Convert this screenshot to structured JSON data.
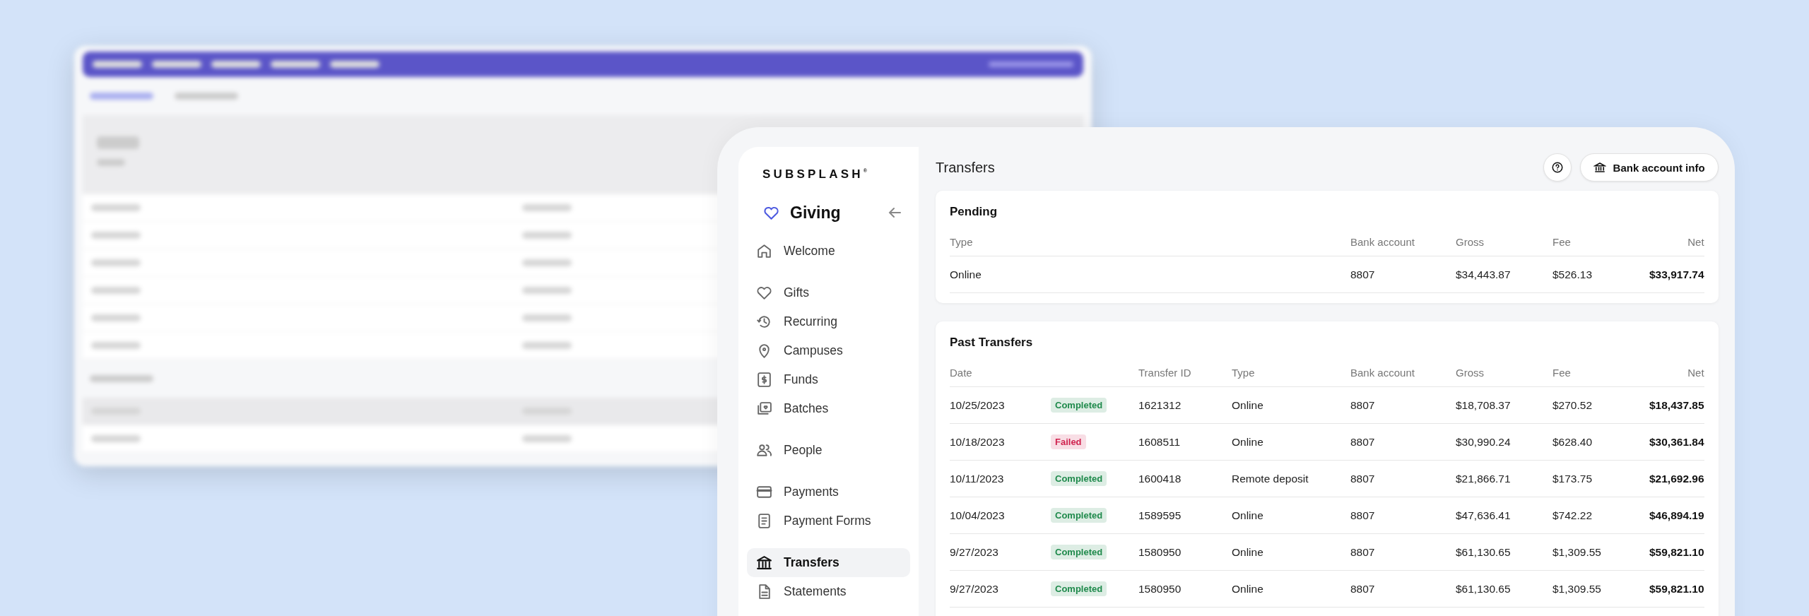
{
  "sidebar": {
    "logo": "SUBSPLASH$^{®}$",
    "app_title": "Giving",
    "sections": [
      {
        "items": [
          {
            "label": "Welcome",
            "selected": false
          }
        ]
      },
      {
        "items": [
          {
            "label": "Gifts",
            "selected": false
          },
          {
            "label": "Recurring",
            "selected": false
          },
          {
            "label": "Campuses",
            "selected": false
          },
          {
            "label": "Funds",
            "selected": false
          },
          {
            "label": "Batches",
            "selected": false
          }
        ]
      },
      {
        "items": [
          {
            "label": "People",
            "selected": false
          }
        ]
      },
      {
        "items": [
          {
            "label": "Payments",
            "selected": false
          },
          {
            "label": "Payment Forms",
            "selected": false
          }
        ]
      },
      {
        "items": [
          {
            "label": "Transfers",
            "selected": true
          },
          {
            "label": "Statements",
            "selected": false
          }
        ]
      }
    ]
  },
  "page_title": "Transfers",
  "bank_button": "Bank account info",
  "pending": {
    "title": "Pending",
    "columns": [
      "Type",
      "Bank account",
      "Gross",
      "Fee",
      "Net"
    ],
    "rows": [
      {
        "type": "Online",
        "bank_account": "8807",
        "gross": "$34,443.87",
        "fee": "$526.13",
        "net": "$33,917.74"
      }
    ]
  },
  "past": {
    "title": "Past Transfers",
    "columns": [
      "Date",
      "Transfer ID",
      "Type",
      "Bank account",
      "Gross",
      "Fee",
      "Net"
    ],
    "rows": [
      {
        "date": "10/25/2023",
        "status": "Completed",
        "color": "#1f8a4c",
        "transfer_id": "1621312",
        "type": "Online",
        "bank_account": "8807",
        "gross": "$18,708.37",
        "fee": "$270.52",
        "net": "$18,437.85"
      },
      {
        "date": "10/18/2023",
        "status": "Failed",
        "color": "#d0234f",
        "transfer_id": "1608511",
        "type": "Online",
        "bank_account": "8807",
        "gross": "$30,990.24",
        "fee": "$628.40",
        "net": "$30,361.84"
      },
      {
        "date": "10/11/2023",
        "status": "Completed",
        "color": "#1f8a4c",
        "transfer_id": "1600418",
        "type": "Remote deposit",
        "bank_account": "8807",
        "gross": "$21,866.71",
        "fee": "$173.75",
        "net": "$21,692.96"
      },
      {
        "date": "10/04/2023",
        "status": "Completed",
        "color": "#1f8a4c",
        "transfer_id": "1589595",
        "type": "Online",
        "bank_account": "8807",
        "gross": "$47,636.41",
        "fee": "$742.22",
        "net": "$46,894.19"
      },
      {
        "date": "9/27/2023",
        "status": "Completed",
        "color": "#1f8a4c",
        "transfer_id": "1580950",
        "type": "Online",
        "bank_account": "8807",
        "gross": "$61,130.65",
        "fee": "$1,309.55",
        "net": "$59,821.10"
      },
      {
        "date": "9/27/2023",
        "status": "Completed",
        "color": "#1f8a4c",
        "transfer_id": "1580950",
        "type": "Online",
        "bank_account": "8807",
        "gross": "$61,130.65",
        "fee": "$1,309.55",
        "net": "$59,821.10"
      }
    ]
  }
}
